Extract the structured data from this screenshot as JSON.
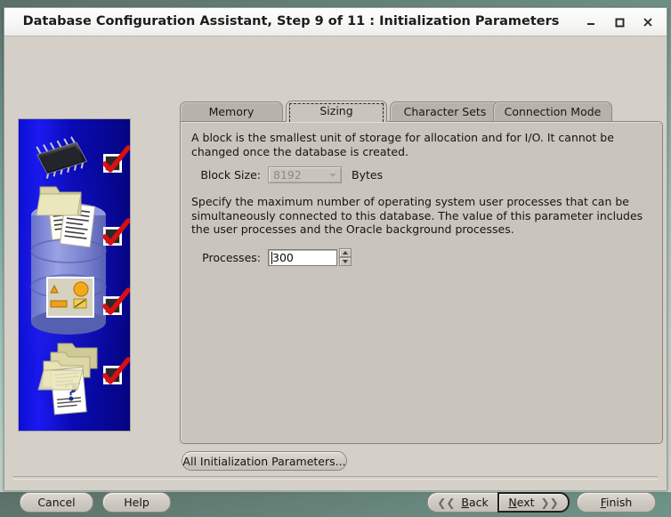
{
  "window": {
    "title": "Database Configuration Assistant, Step 9 of 11 : Initialization Parameters",
    "controls": {
      "minimize": "minimize-icon",
      "maximize": "maximize-icon",
      "close": "close-icon"
    }
  },
  "sidebar": {
    "icon_name": "dbca-wizard-graphic",
    "elements": [
      "cpu-chip-icon",
      "database-cylinder-icon",
      "documents-icon",
      "tool-palette-icon",
      "folders-icon",
      "question-document-icon"
    ],
    "checkmarks": 4,
    "colors": {
      "background_dark": "#0000cc",
      "background_bright": "#1414f0",
      "cylinder": "#8d96d8",
      "folder": "#e6e0b4",
      "check_red": "#d81010"
    }
  },
  "tabs": [
    {
      "label": "Memory",
      "active": false
    },
    {
      "label": "Sizing",
      "active": true
    },
    {
      "label": "Character Sets",
      "active": false
    },
    {
      "label": "Connection Mode",
      "active": false
    }
  ],
  "panel": {
    "block_paragraph": "A block is the smallest unit of storage for allocation and for I/O. It cannot be changed once the database is created.",
    "block_size": {
      "label": "Block Size:",
      "value": "8192",
      "unit": "Bytes",
      "enabled": false
    },
    "processes_paragraph": "Specify the maximum number of operating system user processes that can be simultaneously connected to this database. The value of this parameter includes the user processes and the Oracle background processes.",
    "processes": {
      "label": "Processes:",
      "value": "300",
      "enabled": true
    }
  },
  "buttons": {
    "all_init_params": "All Initialization Parameters...",
    "cancel": "Cancel",
    "help": "Help",
    "back": {
      "label": "Back",
      "mnemonic": "B",
      "chevron": "chevron-left-icon"
    },
    "next": {
      "label": "Next",
      "mnemonic": "N",
      "chevron": "chevron-right-icon",
      "focused": true
    },
    "finish": {
      "label": "Finish",
      "mnemonic": "F"
    }
  }
}
